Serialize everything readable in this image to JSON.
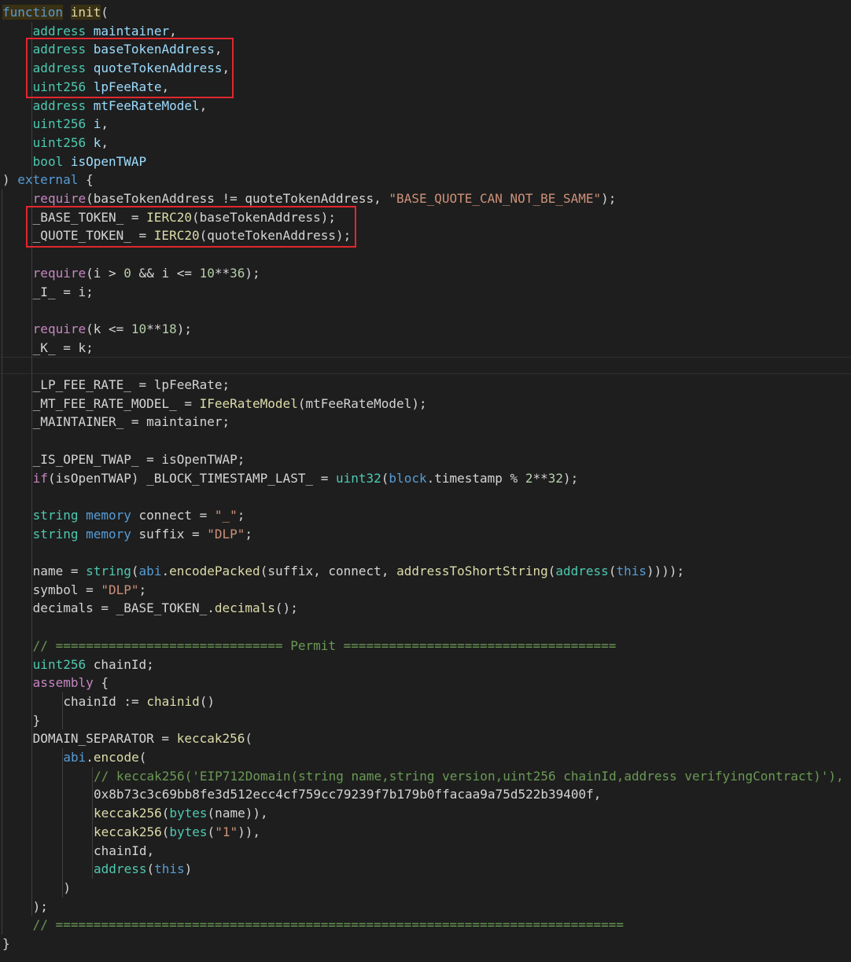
{
  "colors": {
    "background": "#1e1e1e",
    "text": "#d4d4d4",
    "keyword": "#569cd6",
    "type": "#4ec9b0",
    "function": "#dcdcaa",
    "variable": "#9cdcfe",
    "string": "#ce9178",
    "number": "#b5cea8",
    "comment": "#6a9955",
    "control": "#c586c0",
    "highlight_box": "#e3262e"
  },
  "code_lines": [
    {
      "indent": 0,
      "tokens": [
        {
          "c": "kw",
          "t": "function"
        },
        {
          "c": "txt",
          "t": " "
        },
        {
          "c": "fn",
          "t": "init"
        },
        {
          "c": "txt",
          "t": "("
        }
      ]
    },
    {
      "indent": 4,
      "tokens": [
        {
          "c": "ty",
          "t": "address"
        },
        {
          "c": "txt",
          "t": " "
        },
        {
          "c": "var",
          "t": "maintainer"
        },
        {
          "c": "txt",
          "t": ","
        }
      ]
    },
    {
      "indent": 4,
      "tokens": [
        {
          "c": "ty",
          "t": "address"
        },
        {
          "c": "txt",
          "t": " "
        },
        {
          "c": "var",
          "t": "baseTokenAddress"
        },
        {
          "c": "txt",
          "t": ","
        }
      ]
    },
    {
      "indent": 4,
      "tokens": [
        {
          "c": "ty",
          "t": "address"
        },
        {
          "c": "txt",
          "t": " "
        },
        {
          "c": "var",
          "t": "quoteTokenAddress"
        },
        {
          "c": "txt",
          "t": ","
        }
      ]
    },
    {
      "indent": 4,
      "tokens": [
        {
          "c": "ty",
          "t": "uint256"
        },
        {
          "c": "txt",
          "t": " "
        },
        {
          "c": "var",
          "t": "lpFeeRate"
        },
        {
          "c": "txt",
          "t": ","
        }
      ]
    },
    {
      "indent": 4,
      "tokens": [
        {
          "c": "ty",
          "t": "address"
        },
        {
          "c": "txt",
          "t": " "
        },
        {
          "c": "var",
          "t": "mtFeeRateModel"
        },
        {
          "c": "txt",
          "t": ","
        }
      ]
    },
    {
      "indent": 4,
      "tokens": [
        {
          "c": "ty",
          "t": "uint256"
        },
        {
          "c": "txt",
          "t": " "
        },
        {
          "c": "var",
          "t": "i"
        },
        {
          "c": "txt",
          "t": ","
        }
      ]
    },
    {
      "indent": 4,
      "tokens": [
        {
          "c": "ty",
          "t": "uint256"
        },
        {
          "c": "txt",
          "t": " "
        },
        {
          "c": "var",
          "t": "k"
        },
        {
          "c": "txt",
          "t": ","
        }
      ]
    },
    {
      "indent": 4,
      "tokens": [
        {
          "c": "ty",
          "t": "bool"
        },
        {
          "c": "txt",
          "t": " "
        },
        {
          "c": "var",
          "t": "isOpenTWAP"
        }
      ]
    },
    {
      "indent": 0,
      "tokens": [
        {
          "c": "txt",
          "t": ") "
        },
        {
          "c": "kw",
          "t": "external"
        },
        {
          "c": "txt",
          "t": " {"
        }
      ]
    },
    {
      "indent": 4,
      "tokens": [
        {
          "c": "ctl",
          "t": "require"
        },
        {
          "c": "txt",
          "t": "(baseTokenAddress != quoteTokenAddress, "
        },
        {
          "c": "str",
          "t": "\"BASE_QUOTE_CAN_NOT_BE_SAME\""
        },
        {
          "c": "txt",
          "t": ");"
        }
      ]
    },
    {
      "indent": 4,
      "tokens": [
        {
          "c": "txt",
          "t": "_BASE_TOKEN_ = "
        },
        {
          "c": "fn",
          "t": "IERC20"
        },
        {
          "c": "txt",
          "t": "(baseTokenAddress);"
        }
      ]
    },
    {
      "indent": 4,
      "tokens": [
        {
          "c": "txt",
          "t": "_QUOTE_TOKEN_ = "
        },
        {
          "c": "fn",
          "t": "IERC20"
        },
        {
          "c": "txt",
          "t": "(quoteTokenAddress);"
        }
      ]
    },
    {
      "indent": 0,
      "tokens": []
    },
    {
      "indent": 4,
      "tokens": [
        {
          "c": "ctl",
          "t": "require"
        },
        {
          "c": "txt",
          "t": "(i > "
        },
        {
          "c": "num",
          "t": "0"
        },
        {
          "c": "txt",
          "t": " && i <= "
        },
        {
          "c": "num",
          "t": "10"
        },
        {
          "c": "txt",
          "t": "**"
        },
        {
          "c": "num",
          "t": "36"
        },
        {
          "c": "txt",
          "t": ");"
        }
      ]
    },
    {
      "indent": 4,
      "tokens": [
        {
          "c": "txt",
          "t": "_I_ = i;"
        }
      ]
    },
    {
      "indent": 0,
      "tokens": []
    },
    {
      "indent": 4,
      "tokens": [
        {
          "c": "ctl",
          "t": "require"
        },
        {
          "c": "txt",
          "t": "(k <= "
        },
        {
          "c": "num",
          "t": "10"
        },
        {
          "c": "txt",
          "t": "**"
        },
        {
          "c": "num",
          "t": "18"
        },
        {
          "c": "txt",
          "t": ");"
        }
      ]
    },
    {
      "indent": 4,
      "tokens": [
        {
          "c": "txt",
          "t": "_K_ = k;"
        }
      ]
    },
    {
      "indent": 0,
      "tokens": []
    },
    {
      "indent": 4,
      "tokens": [
        {
          "c": "txt",
          "t": "_LP_FEE_RATE_ = lpFeeRate;"
        }
      ]
    },
    {
      "indent": 4,
      "tokens": [
        {
          "c": "txt",
          "t": "_MT_FEE_RATE_MODEL_ = "
        },
        {
          "c": "fn",
          "t": "IFeeRateModel"
        },
        {
          "c": "txt",
          "t": "(mtFeeRateModel);"
        }
      ]
    },
    {
      "indent": 4,
      "tokens": [
        {
          "c": "txt",
          "t": "_MAINTAINER_ = maintainer;"
        }
      ]
    },
    {
      "indent": 0,
      "tokens": []
    },
    {
      "indent": 4,
      "tokens": [
        {
          "c": "txt",
          "t": "_IS_OPEN_TWAP_ = isOpenTWAP;"
        }
      ]
    },
    {
      "indent": 4,
      "tokens": [
        {
          "c": "ctl",
          "t": "if"
        },
        {
          "c": "txt",
          "t": "(isOpenTWAP) _BLOCK_TIMESTAMP_LAST_ = "
        },
        {
          "c": "ty",
          "t": "uint32"
        },
        {
          "c": "txt",
          "t": "("
        },
        {
          "c": "kw",
          "t": "block"
        },
        {
          "c": "txt",
          "t": ".timestamp % "
        },
        {
          "c": "num",
          "t": "2"
        },
        {
          "c": "txt",
          "t": "**"
        },
        {
          "c": "num",
          "t": "32"
        },
        {
          "c": "txt",
          "t": ");"
        }
      ]
    },
    {
      "indent": 0,
      "tokens": []
    },
    {
      "indent": 4,
      "tokens": [
        {
          "c": "ty",
          "t": "string"
        },
        {
          "c": "txt",
          "t": " "
        },
        {
          "c": "kw",
          "t": "memory"
        },
        {
          "c": "txt",
          "t": " connect = "
        },
        {
          "c": "str",
          "t": "\"_\""
        },
        {
          "c": "txt",
          "t": ";"
        }
      ]
    },
    {
      "indent": 4,
      "tokens": [
        {
          "c": "ty",
          "t": "string"
        },
        {
          "c": "txt",
          "t": " "
        },
        {
          "c": "kw",
          "t": "memory"
        },
        {
          "c": "txt",
          "t": " suffix = "
        },
        {
          "c": "str",
          "t": "\"DLP\""
        },
        {
          "c": "txt",
          "t": ";"
        }
      ]
    },
    {
      "indent": 0,
      "tokens": []
    },
    {
      "indent": 4,
      "tokens": [
        {
          "c": "txt",
          "t": "name = "
        },
        {
          "c": "ty",
          "t": "string"
        },
        {
          "c": "txt",
          "t": "("
        },
        {
          "c": "kw",
          "t": "abi"
        },
        {
          "c": "txt",
          "t": "."
        },
        {
          "c": "fn",
          "t": "encodePacked"
        },
        {
          "c": "txt",
          "t": "(suffix, connect, "
        },
        {
          "c": "fn",
          "t": "addressToShortString"
        },
        {
          "c": "txt",
          "t": "("
        },
        {
          "c": "ty",
          "t": "address"
        },
        {
          "c": "txt",
          "t": "("
        },
        {
          "c": "kw",
          "t": "this"
        },
        {
          "c": "txt",
          "t": "))));"
        }
      ]
    },
    {
      "indent": 4,
      "tokens": [
        {
          "c": "txt",
          "t": "symbol = "
        },
        {
          "c": "str",
          "t": "\"DLP\""
        },
        {
          "c": "txt",
          "t": ";"
        }
      ]
    },
    {
      "indent": 4,
      "tokens": [
        {
          "c": "txt",
          "t": "decimals = _BASE_TOKEN_."
        },
        {
          "c": "fn",
          "t": "decimals"
        },
        {
          "c": "txt",
          "t": "();"
        }
      ]
    },
    {
      "indent": 0,
      "tokens": []
    },
    {
      "indent": 4,
      "tokens": [
        {
          "c": "com",
          "t": "// ============================== Permit ===================================="
        }
      ]
    },
    {
      "indent": 4,
      "tokens": [
        {
          "c": "ty",
          "t": "uint256"
        },
        {
          "c": "txt",
          "t": " chainId;"
        }
      ]
    },
    {
      "indent": 4,
      "tokens": [
        {
          "c": "ctl",
          "t": "assembly"
        },
        {
          "c": "txt",
          "t": " {"
        }
      ]
    },
    {
      "indent": 8,
      "tokens": [
        {
          "c": "txt",
          "t": "chainId := "
        },
        {
          "c": "fn",
          "t": "chainid"
        },
        {
          "c": "txt",
          "t": "()"
        }
      ]
    },
    {
      "indent": 4,
      "tokens": [
        {
          "c": "txt",
          "t": "}"
        }
      ]
    },
    {
      "indent": 4,
      "tokens": [
        {
          "c": "txt",
          "t": "DOMAIN_SEPARATOR = "
        },
        {
          "c": "fn",
          "t": "keccak256"
        },
        {
          "c": "txt",
          "t": "("
        }
      ]
    },
    {
      "indent": 8,
      "tokens": [
        {
          "c": "kw",
          "t": "abi"
        },
        {
          "c": "txt",
          "t": "."
        },
        {
          "c": "fn",
          "t": "encode"
        },
        {
          "c": "txt",
          "t": "("
        }
      ]
    },
    {
      "indent": 12,
      "tokens": [
        {
          "c": "com",
          "t": "// keccak256('EIP712Domain(string name,string version,uint256 chainId,address verifyingContract)'),"
        }
      ]
    },
    {
      "indent": 12,
      "tokens": [
        {
          "c": "txt",
          "t": "0x8b73c3c69bb8fe3d512ecc4cf759cc79239f7b179b0ffacaa9a75d522b39400f,"
        }
      ]
    },
    {
      "indent": 12,
      "tokens": [
        {
          "c": "fn",
          "t": "keccak256"
        },
        {
          "c": "txt",
          "t": "("
        },
        {
          "c": "ty",
          "t": "bytes"
        },
        {
          "c": "txt",
          "t": "(name)),"
        }
      ]
    },
    {
      "indent": 12,
      "tokens": [
        {
          "c": "fn",
          "t": "keccak256"
        },
        {
          "c": "txt",
          "t": "("
        },
        {
          "c": "ty",
          "t": "bytes"
        },
        {
          "c": "txt",
          "t": "("
        },
        {
          "c": "str",
          "t": "\"1\""
        },
        {
          "c": "txt",
          "t": ")),"
        }
      ]
    },
    {
      "indent": 12,
      "tokens": [
        {
          "c": "txt",
          "t": "chainId,"
        }
      ]
    },
    {
      "indent": 12,
      "tokens": [
        {
          "c": "ty",
          "t": "address"
        },
        {
          "c": "txt",
          "t": "("
        },
        {
          "c": "kw",
          "t": "this"
        },
        {
          "c": "txt",
          "t": ")"
        }
      ]
    },
    {
      "indent": 8,
      "tokens": [
        {
          "c": "txt",
          "t": ")"
        }
      ]
    },
    {
      "indent": 4,
      "tokens": [
        {
          "c": "txt",
          "t": ");"
        }
      ]
    },
    {
      "indent": 4,
      "tokens": [
        {
          "c": "com",
          "t": "// ==========================================================================="
        }
      ]
    },
    {
      "indent": 0,
      "tokens": [
        {
          "c": "txt",
          "t": "}"
        }
      ]
    }
  ]
}
